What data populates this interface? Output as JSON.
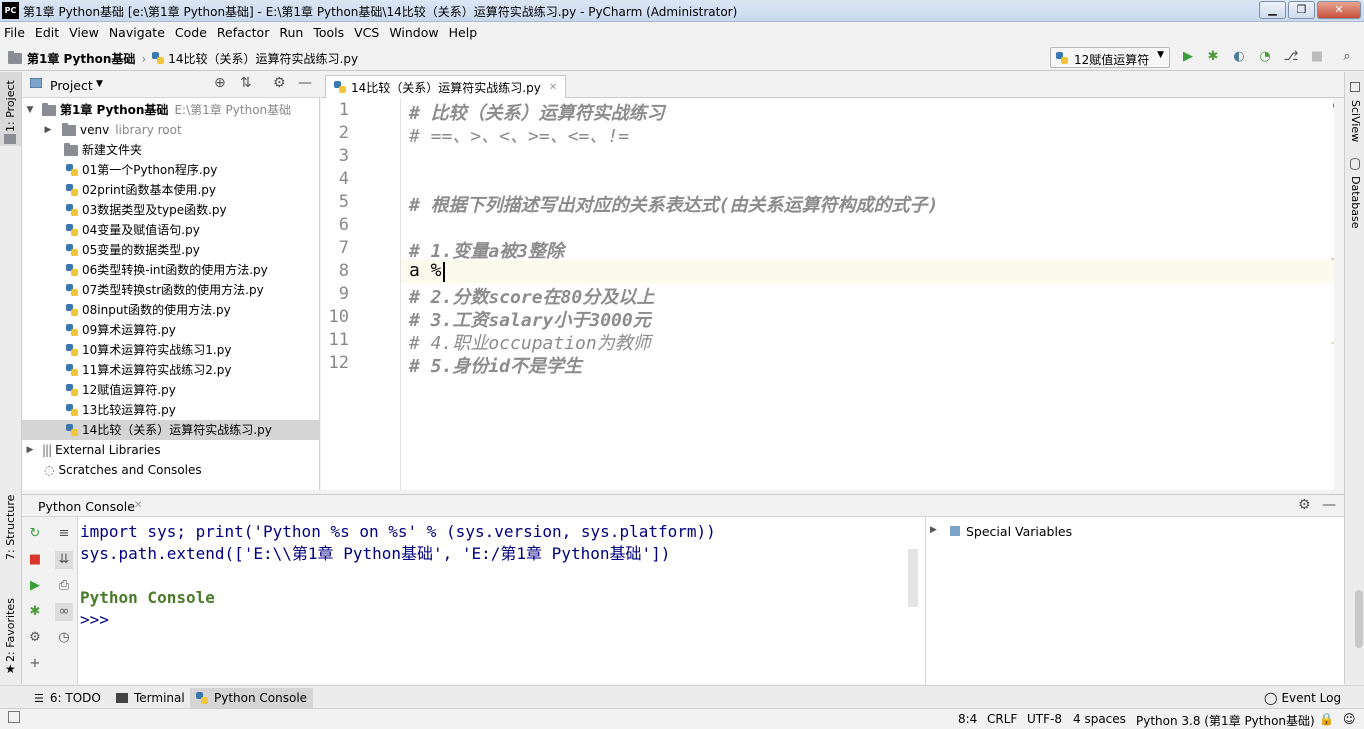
{
  "window": {
    "title": "第1章 Python基础 [e:\\第1章 Python基础] - E:\\第1章 Python基础\\14比较（关系）运算符实战练习.py - PyCharm (Administrator)",
    "app_icon": "PC"
  },
  "menu": [
    "File",
    "Edit",
    "View",
    "Navigate",
    "Code",
    "Refactor",
    "Run",
    "Tools",
    "VCS",
    "Window",
    "Help"
  ],
  "nav": {
    "project": "第1章 Python基础",
    "file": "14比较（关系）运算符实战练习.py",
    "run_config": "12赋值运算符"
  },
  "left_strip": {
    "project": "1: Project",
    "structure": "7: Structure",
    "favorites": "2: Favorites"
  },
  "right_strip": {
    "sciview": "SciView",
    "database": "Database"
  },
  "project_panel": {
    "header": "Project",
    "root": {
      "name": "第1章 Python基础",
      "path": "E:\\第1章 Python基础"
    },
    "venv": {
      "name": "venv",
      "tag": "library root"
    },
    "folder": "新建文件夹",
    "files": [
      "01第一个Python程序.py",
      "02print函数基本使用.py",
      "03数据类型及type函数.py",
      "04变量及赋值语句.py",
      "05变量的数据类型.py",
      "06类型转换-int函数的使用方法.py",
      "07类型转换str函数的使用方法.py",
      "08input函数的使用方法.py",
      "09算术运算符.py",
      "10算术运算符实战练习1.py",
      "11算术运算符实战练习2.py",
      "12赋值运算符.py",
      "13比较运算符.py",
      "14比较（关系）运算符实战练习.py"
    ],
    "external": "External Libraries",
    "scratches": "Scratches and Consoles"
  },
  "editor": {
    "tab": "14比较（关系）运算符实战练习.py",
    "lines": [
      "# 比较（关系）运算符实战练习",
      "# ==、>、<、>=、<=、!=",
      "",
      "",
      "# 根据下列描述写出对应的关系表达式(由关系运算符构成的式子)",
      "",
      "# 1.变量a被3整除",
      "a %",
      "# 2.分数score在80分及以上",
      "# 3.工资salary小于3000元",
      "# 4.职业occupation为教师",
      "# 5.身份id不是学生"
    ],
    "line_numbers": [
      "1",
      "2",
      "3",
      "4",
      "5",
      "6",
      "7",
      "8",
      "9",
      "10",
      "11",
      "12"
    ]
  },
  "console": {
    "tab": "Python Console",
    "lines": [
      "import sys; print('Python %s on %s' % (sys.version, sys.platform))",
      "sys.path.extend(['E:\\\\第1章 Python基础', 'E:/第1章 Python基础'])",
      "",
      "Python Console",
      ">>>"
    ],
    "special_vars": "Special Variables"
  },
  "bottom_tabs": {
    "todo": "6: TODO",
    "terminal": "Terminal",
    "python_console": "Python Console",
    "event_log": "Event Log"
  },
  "status": {
    "position": "8:4",
    "line_sep": "CRLF",
    "encoding": "UTF-8",
    "indent": "4 spaces",
    "interpreter": "Python 3.8 (第1章 Python基础)"
  }
}
